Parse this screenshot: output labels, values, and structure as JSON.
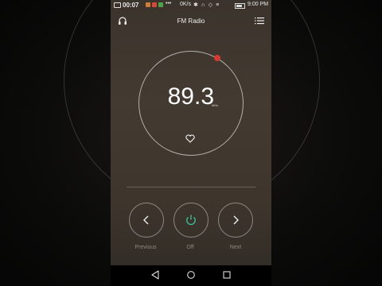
{
  "status_bar": {
    "time": "00:07",
    "notification_dots": "•••",
    "net_speed": "0K/s",
    "connectivity": "✱ ∩ ◇ ≡",
    "clock": "9:00 PM",
    "app_colors": [
      "#d07c3a",
      "#d44a3a",
      "#4aa548"
    ]
  },
  "header": {
    "title": "FM Radio",
    "left_icon": "headphones-icon",
    "right_icon": "station-list-icon"
  },
  "tuner": {
    "frequency": "89.3",
    "unit": "MHz",
    "marker_color": "#d33a33",
    "favorite_icon": "heart-outline-icon"
  },
  "controls": {
    "previous_label": "Previous",
    "power_label": "Off",
    "next_label": "Next",
    "power_color": "#3fbf9f"
  },
  "navigation": {
    "back_icon": "back-triangle-icon",
    "home_icon": "home-circle-icon",
    "recents_icon": "recents-square-icon"
  }
}
